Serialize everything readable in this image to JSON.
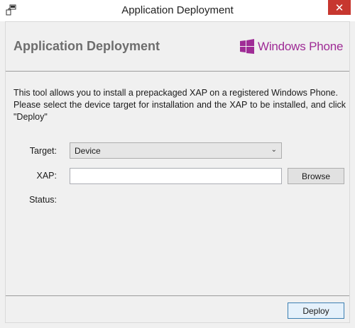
{
  "window": {
    "title": "Application Deployment",
    "close_glyph": "✕",
    "accent_color": "#c7372f"
  },
  "header": {
    "title": "Application Deployment",
    "brand_text": "Windows Phone",
    "brand_color": "#9f2c96"
  },
  "description": {
    "line1": "This tool allows you to install a prepackaged XAP on a registered Windows Phone.",
    "line2": "Please select the device target for installation and the XAP to be installed, and click \"Deploy\""
  },
  "form": {
    "target_label": "Target:",
    "target_value": "Device",
    "xap_label": "XAP:",
    "xap_value": "",
    "browse_label": "Browse",
    "status_label": "Status:",
    "status_value": ""
  },
  "footer": {
    "deploy_label": "Deploy"
  }
}
